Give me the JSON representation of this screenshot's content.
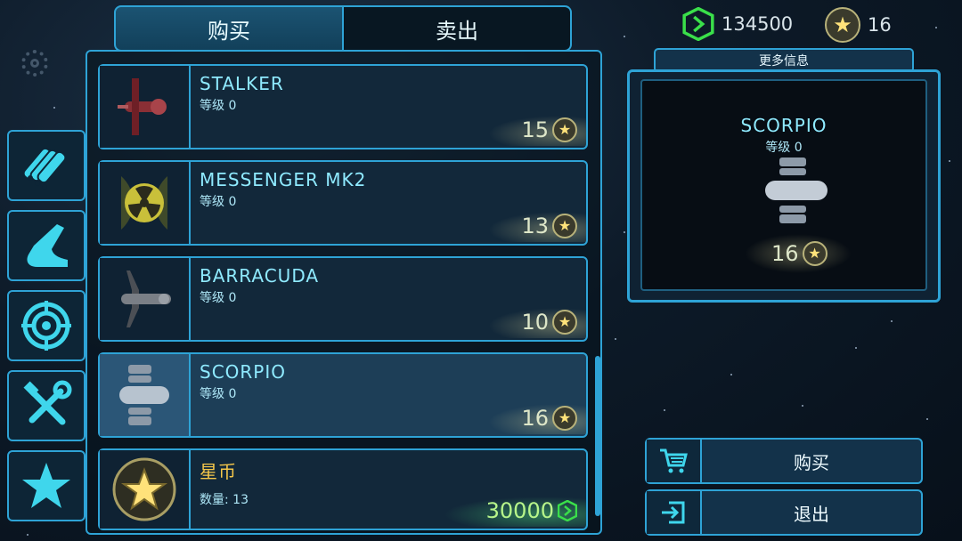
{
  "tabs": {
    "buy": "购买",
    "sell": "卖出"
  },
  "currency": {
    "gems": "134500",
    "stars": "16"
  },
  "categories": [
    "blaster-icon",
    "ship-hull-icon",
    "target-icon",
    "tools-icon",
    "star-icon"
  ],
  "items": [
    {
      "name": "STALKER",
      "level": "等级 0",
      "price": "15",
      "currency": "star"
    },
    {
      "name": "MESSENGER MK2",
      "level": "等级 0",
      "price": "13",
      "currency": "star"
    },
    {
      "name": "BARRACUDA",
      "level": "等级 0",
      "price": "10",
      "currency": "star"
    },
    {
      "name": "SCORPIO",
      "level": "等级 0",
      "price": "16",
      "currency": "star",
      "selected": true
    },
    {
      "name": "星币",
      "level": "数量: 13",
      "price": "30000",
      "currency": "gem"
    }
  ],
  "detail": {
    "more_info": "更多信息",
    "name": "SCORPIO",
    "level": "等级 0",
    "price": "16"
  },
  "actions": {
    "buy": "购买",
    "exit": "退出"
  },
  "colors": {
    "accent": "#2ea3d6",
    "gem": "#3adf4a",
    "star": "#ffe27a",
    "gold_text": "#f5c74a"
  }
}
